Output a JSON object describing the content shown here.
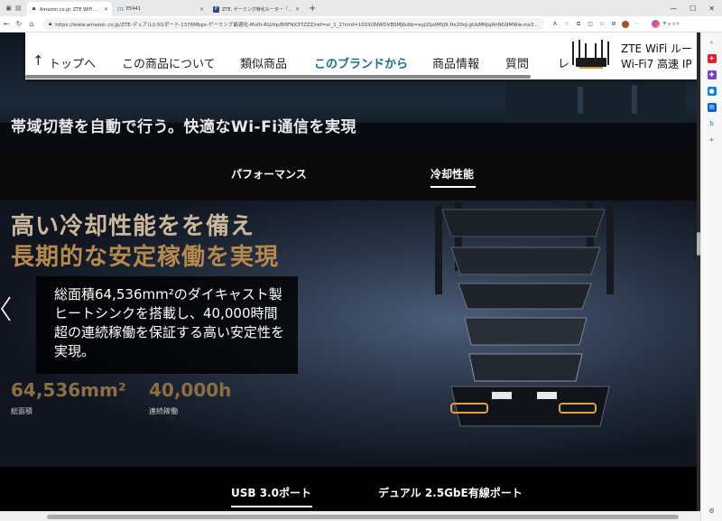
{
  "browser": {
    "tabs": [
      {
        "title": "Amazon.co.jp: ZTE WiFi ルーター 無線...",
        "favicon": "a",
        "active": true
      },
      {
        "title": "E5441",
        "favicon": "ZTE",
        "active": false
      },
      {
        "title": "ZTE, ゲーミング特化ルーター「ZTE Ima...",
        "favicon": "P",
        "active": false
      }
    ],
    "url": "https://www.amazon.co.jp/ZTE-デュアル2-5Gポート-1376Mbps-ゲーミング最適化-Multi-RU/dp/B0FNX3TZZZ/ref=sr_1_1?crid=101SONWDVBSMJ&dib=eyJ2IjoiMSJ9.Hx20oJ-gUoMNJqAhNG9MWw.mv2...",
    "copilot_label": "チャット"
  },
  "subnav": {
    "back_label": "トップへ",
    "items": [
      "この商品について",
      "類似商品",
      "このブランドから",
      "商品情報",
      "質問",
      "レ"
    ],
    "active_index": 2,
    "product_title_line1": "ZTE WiFi ルー",
    "product_title_line2": "Wi-Fi7 高速 IP"
  },
  "hero": {
    "headline": "帯域切替を自動で行う。快適なWi-Fi通信を実現"
  },
  "feature_tabs": {
    "items": [
      "パフォーマンス",
      "冷却性能"
    ],
    "active_index": 1
  },
  "promo": {
    "title_line1": "高い冷却性能をを備え",
    "title_line2": "長期的な安定稼働を実現",
    "description": "総面積64,536mm²のダイキャスト製ヒートシンクを搭載し、40,000時間超の連続稼働を保証する高い安定性を実現。",
    "stats": [
      {
        "value": "64,536mm²",
        "label": "総面積"
      },
      {
        "value": "40,000h",
        "label": "連続稼働"
      }
    ]
  },
  "bottom_tabs": {
    "items": [
      "USB 3.0ポート",
      "デュアル 2.5GbE有線ポート"
    ],
    "active_index": 0
  },
  "colors": {
    "subnav_active": "#1c6b8c",
    "promo_title_light": "#c9b89a",
    "promo_title_gold": "#b58a4c",
    "stat_value": "#8b6e44"
  }
}
